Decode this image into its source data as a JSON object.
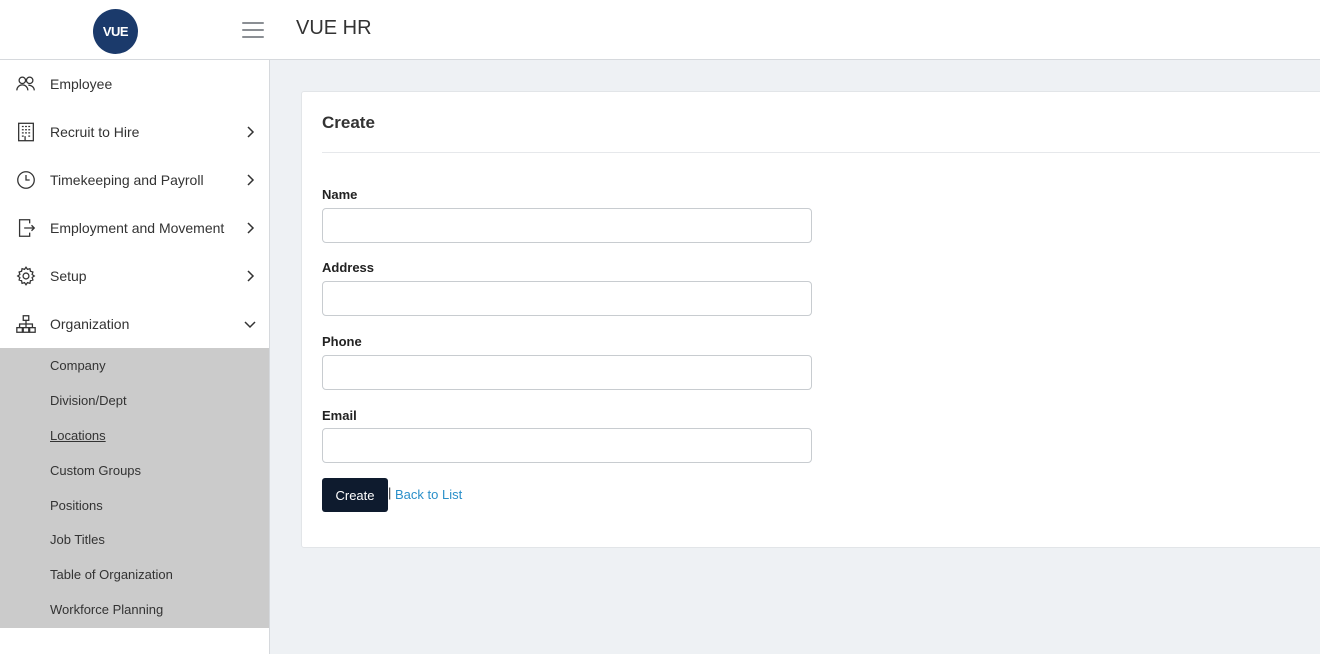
{
  "header": {
    "logo_text": "VUE",
    "app_title": "VUE HR"
  },
  "sidebar": {
    "items": [
      {
        "label": "Employee",
        "icon": "people-icon"
      },
      {
        "label": "Recruit to Hire",
        "icon": "building-icon"
      },
      {
        "label": "Timekeeping and Payroll",
        "icon": "clock-icon"
      },
      {
        "label": "Employment and Movement",
        "icon": "exit-door-icon"
      },
      {
        "label": "Setup",
        "icon": "gear-icon"
      },
      {
        "label": "Organization",
        "icon": "org-chart-icon"
      }
    ],
    "organization_submenu": [
      "Company",
      "Division/Dept",
      "Locations",
      "Custom Groups",
      "Positions",
      "Job Titles",
      "Table of Organization",
      "Workforce Planning"
    ],
    "active_subitem": "Locations"
  },
  "form": {
    "title": "Create",
    "fields": [
      {
        "label": "Name",
        "value": ""
      },
      {
        "label": "Address",
        "value": ""
      },
      {
        "label": "Phone",
        "value": ""
      },
      {
        "label": "Email",
        "value": ""
      }
    ],
    "create_button": "Create",
    "separator": "|",
    "back_link": "Back to List"
  },
  "colors": {
    "logo_bg": "#1b3a6b",
    "submenu_bg": "#cbcbcb",
    "main_bg": "#eef1f4",
    "button_bg": "#0e1b2e",
    "link": "#2a8fc9"
  }
}
